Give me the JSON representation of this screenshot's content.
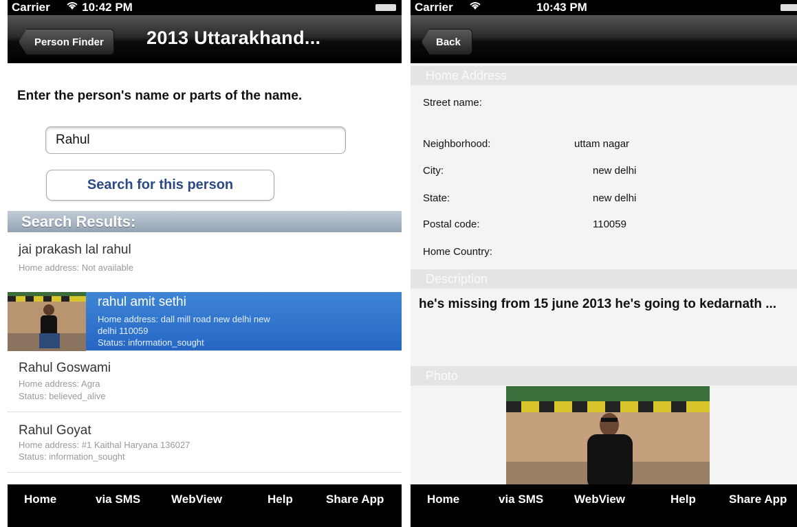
{
  "left": {
    "status": {
      "carrier": "Carrier",
      "time": "10:42 PM"
    },
    "nav": {
      "back_label": "Person Finder",
      "title": "2013 Uttarakhand..."
    },
    "prompt": "Enter the person's name or parts of the name.",
    "search": {
      "value": "Rahul"
    },
    "search_button": "Search for this person",
    "results_header": "Search Results:",
    "results": [
      {
        "name": "jai prakash lal rahul",
        "line1": "Home address: Not available",
        "line2": ""
      },
      {
        "name": "rahul amit sethi",
        "line1": "Home address: dall mill road new delhi new",
        "line1b": "delhi 110059",
        "line2": "Status: information_sought"
      },
      {
        "name": "Rahul Goswami",
        "line1": "Home address:  Agra",
        "line2": "Status: believed_alive"
      },
      {
        "name": "Rahul Goyat",
        "line1": "Home address: #1 Kaithal Haryana 136027",
        "line2": "Status: information_sought"
      }
    ]
  },
  "right": {
    "status": {
      "carrier": "Carrier",
      "time": "10:43 PM"
    },
    "nav": {
      "back_label": "Back"
    },
    "home_address_header": "Home Address",
    "fields": {
      "street_label": "Street name:",
      "neighborhood_label": "Neighborhood:",
      "neighborhood_value": "uttam nagar",
      "city_label": "City:",
      "city_value": "new delhi",
      "state_label": "State:",
      "state_value": "new delhi",
      "postal_label": "Postal code:",
      "postal_value": "110059",
      "country_label": "Home Country:"
    },
    "description_header": "Description",
    "description": "he's missing  from 15 june 2013  he's going to kedarnath ...",
    "photo_header": "Photo"
  },
  "tabs": [
    "Home",
    "via SMS",
    "WebView",
    "Help",
    "Share App"
  ],
  "colors": {
    "selected_row": "#2f74cf",
    "link_blue": "#2c4a86",
    "section_header": "#a8b6c4"
  }
}
